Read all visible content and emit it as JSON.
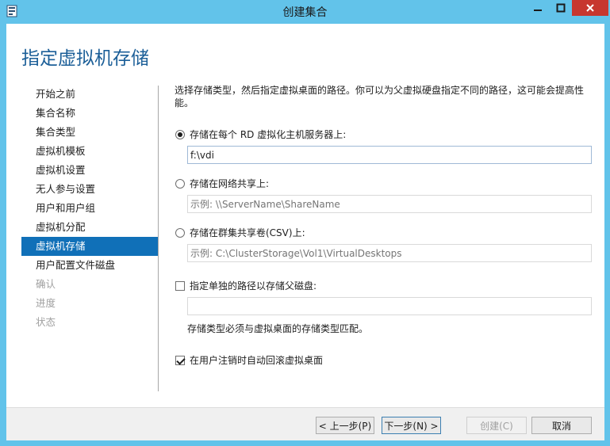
{
  "window": {
    "title": "创建集合",
    "app_icon": "server-manager-icon",
    "controls": {
      "minimize_icon": "minimize-icon",
      "maximize_icon": "maximize-icon",
      "close_icon": "close-icon"
    }
  },
  "page": {
    "title": "指定虚拟机存储"
  },
  "nav": {
    "items": [
      {
        "label": "开始之前",
        "state": "normal"
      },
      {
        "label": "集合名称",
        "state": "normal"
      },
      {
        "label": "集合类型",
        "state": "normal"
      },
      {
        "label": "虚拟机模板",
        "state": "normal"
      },
      {
        "label": "虚拟机设置",
        "state": "normal"
      },
      {
        "label": "无人参与设置",
        "state": "normal"
      },
      {
        "label": "用户和用户组",
        "state": "normal"
      },
      {
        "label": "虚拟机分配",
        "state": "normal"
      },
      {
        "label": "虚拟机存储",
        "state": "active"
      },
      {
        "label": "用户配置文件磁盘",
        "state": "normal"
      },
      {
        "label": "确认",
        "state": "disabled"
      },
      {
        "label": "进度",
        "state": "disabled"
      },
      {
        "label": "状态",
        "state": "disabled"
      }
    ]
  },
  "content": {
    "description": "选择存储类型，然后指定虚拟桌面的路径。你可以为父虚拟硬盘指定不同的路径，这可能会提高性能。",
    "option_local": {
      "label": "存储在每个 RD 虚拟化主机服务器上:",
      "checked": true,
      "value": "f:\\vdi"
    },
    "option_share": {
      "label": "存储在网络共享上:",
      "checked": false,
      "placeholder": "示例: \\\\ServerName\\ShareName"
    },
    "option_csv": {
      "label": "存储在群集共享卷(CSV)上:",
      "checked": false,
      "placeholder": "示例: C:\\ClusterStorage\\Vol1\\VirtualDesktops"
    },
    "parent_disk": {
      "label": "指定单独的路径以存储父磁盘:",
      "checked": false,
      "value": ""
    },
    "note": "存储类型必须与虚拟桌面的存储类型匹配。",
    "rollback": {
      "label": "在用户注销时自动回滚虚拟桌面",
      "checked": true
    }
  },
  "footer": {
    "prev": "< 上一步(P)",
    "next": "下一步(N) >",
    "create": "创建(C)",
    "cancel": "取消"
  },
  "colors": {
    "frame": "#62c3ea",
    "close": "#c7372f",
    "title": "#1c5f98",
    "nav_active": "#1070b8"
  }
}
